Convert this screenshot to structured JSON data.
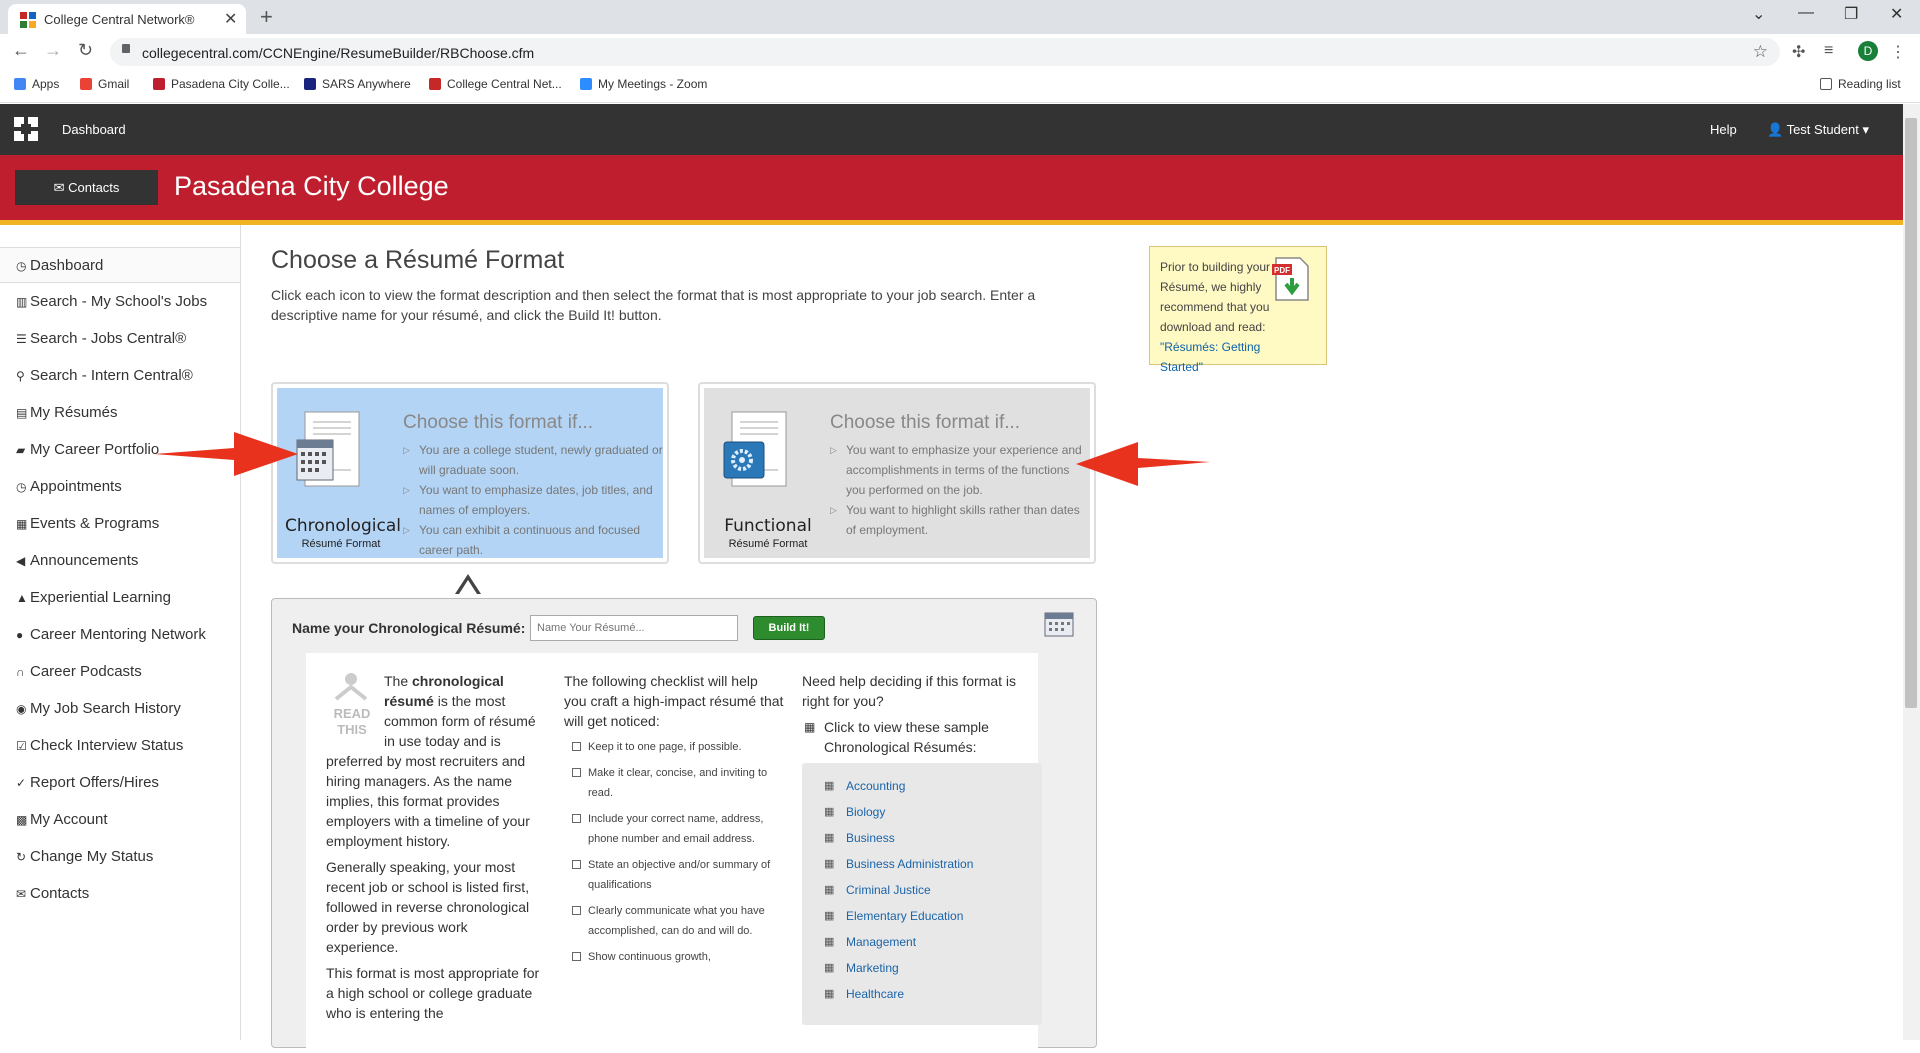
{
  "browser": {
    "tab_title": "College Central Network®",
    "url": "collegecentral.com/CCNEngine/ResumeBuilder/RBChoose.cfm",
    "profile_initial": "D",
    "bookmarks": [
      "Apps",
      "Gmail",
      "Pasadena City Colle...",
      "SARS Anywhere",
      "College Central Net...",
      "My Meetings - Zoom"
    ],
    "reading_list": "Reading list"
  },
  "appnav": {
    "dashboard": "Dashboard",
    "help": "Help",
    "user": "Test Student"
  },
  "banner": {
    "contacts": "Contacts",
    "school": "Pasadena City College"
  },
  "sidebar": {
    "items": [
      {
        "label": "Dashboard",
        "icon": "clock-icon"
      },
      {
        "label": "Search - My School's Jobs",
        "icon": "building-icon"
      },
      {
        "label": "Search - Jobs Central®",
        "icon": "list-icon"
      },
      {
        "label": "Search - Intern Central®",
        "icon": "user-search-icon"
      },
      {
        "label": "My Résumés",
        "icon": "document-icon"
      },
      {
        "label": "My Career Portfolio",
        "icon": "briefcase-icon"
      },
      {
        "label": "Appointments",
        "icon": "clock-icon"
      },
      {
        "label": "Events & Programs",
        "icon": "calendar-icon"
      },
      {
        "label": "Announcements",
        "icon": "megaphone-icon"
      },
      {
        "label": "Experiential Learning",
        "icon": "graduation-cap-icon"
      },
      {
        "label": "Career Mentoring Network",
        "icon": "user-icon"
      },
      {
        "label": "Career Podcasts",
        "icon": "headphones-icon"
      },
      {
        "label": "My Job Search History",
        "icon": "eye-icon"
      },
      {
        "label": "Check Interview Status",
        "icon": "check-square-icon"
      },
      {
        "label": "Report Offers/Hires",
        "icon": "thumbs-up-icon"
      },
      {
        "label": "My Account",
        "icon": "sitemap-icon"
      },
      {
        "label": "Change My Status",
        "icon": "refresh-icon"
      },
      {
        "label": "Contacts",
        "icon": "envelope-icon"
      }
    ]
  },
  "main": {
    "title": "Choose a Résumé Format",
    "intro": "Click each icon to view the format description and then select the format that is most appropriate to your job search. Enter a descriptive name for your résumé, and click the Build It! button.",
    "pdf_note": "Prior to building your Résumé, we highly recommend that you download and read: ",
    "pdf_link": "\"Résumés: Getting Started\"",
    "formats": [
      {
        "label": "Chronological",
        "sublabel": "Résumé Format",
        "heading": "Choose this format if...",
        "bullets": [
          "You are a college student, newly graduated or will graduate soon.",
          "You want to emphasize dates, job titles, and names of employers.",
          "You can exhibit a continuous and focused career path."
        ]
      },
      {
        "label": "Functional",
        "sublabel": "Résumé Format",
        "heading": "Choose this format if...",
        "bullets": [
          "You want to emphasize your experience and accomplishments in terms of the functions you performed on the job.",
          "You want to highlight skills rather than dates of employment."
        ]
      }
    ],
    "name_label": "Name your Chronological Résumé:",
    "name_placeholder": "Name Your Résumé...",
    "build_button": "Build It!",
    "read_this_1": "READ",
    "read_this_2": "THIS",
    "col1_p1_a": "The ",
    "col1_p1_b": "chronological résumé",
    "col1_p1_c": " is the most common form of résumé in use today and is preferred by most recruiters and hiring managers. As the name implies, this format provides employers with a timeline of your employment history.",
    "col1_p2": "Generally speaking, your most recent job or school is listed first, followed in reverse chronological order by previous work experience.",
    "col1_p3": "This format is most appropriate for a high school or college graduate who is entering the",
    "checklist_intro": "The following checklist will help you craft a high-impact résumé that will get noticed:",
    "checklist": [
      "Keep it to one page, if possible.",
      "Make it clear, concise, and inviting to read.",
      "Include your correct name, address, phone number and email address.",
      "State an objective and/or summary of qualifications",
      "Clearly communicate what you have accomplished, can do and will do.",
      "Show continuous growth,"
    ],
    "help_text": "Need help deciding if this format is right for you?",
    "samples_head": "Click to view these sample Chronological Résumés:",
    "samples": [
      "Accounting",
      "Biology",
      "Business",
      "Business Administration",
      "Criminal Justice",
      "Elementary Education",
      "Management",
      "Marketing",
      "Healthcare"
    ]
  },
  "colors": {
    "nav": "#333333",
    "banner": "#be1e2d",
    "banner_stripe": "#f0b323",
    "selected_format": "#b3d4f5",
    "arrow": "#e8321e",
    "link": "#1a64a8"
  }
}
